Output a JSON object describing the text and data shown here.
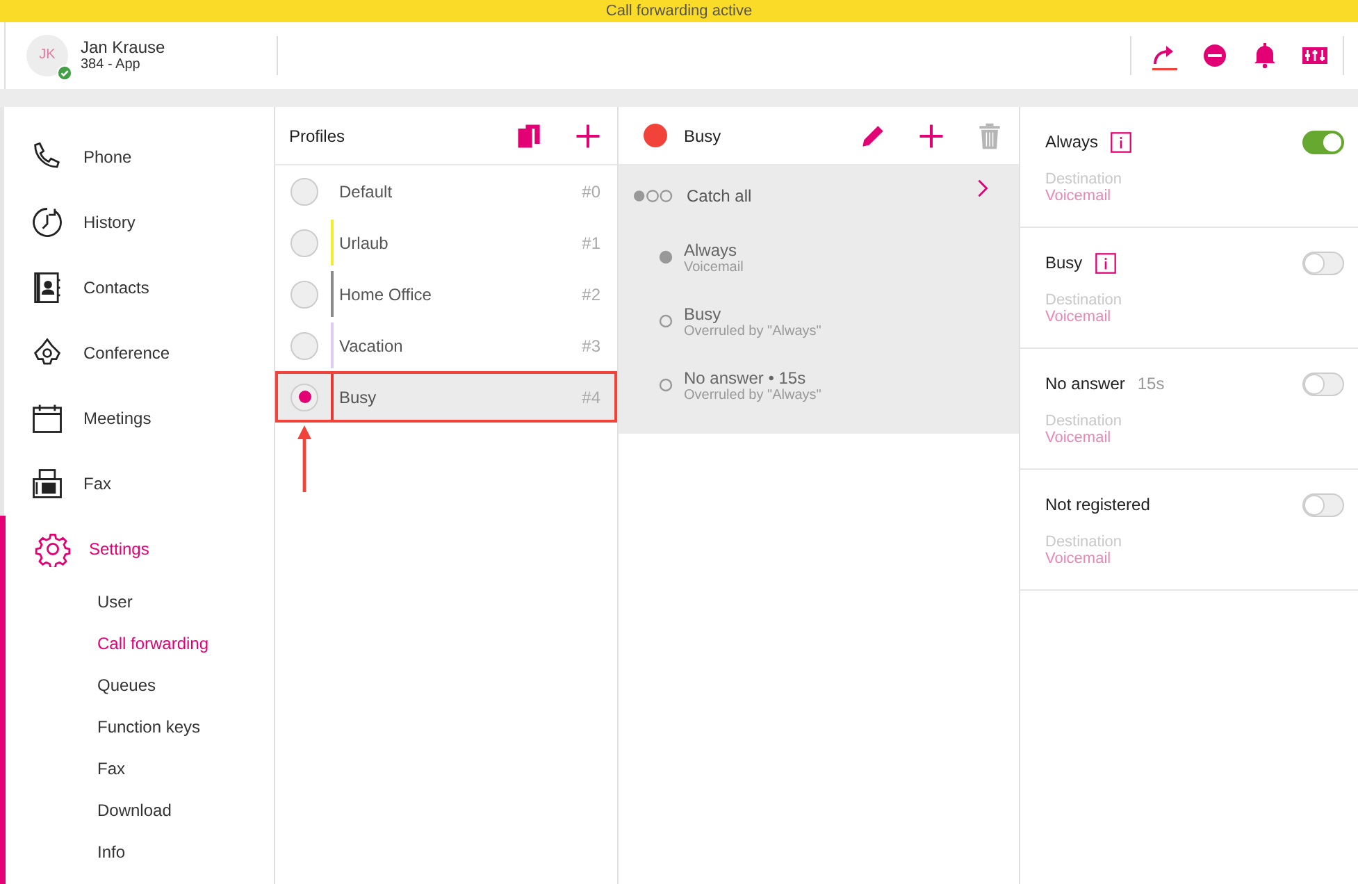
{
  "banner": {
    "text": "Call forwarding active"
  },
  "user": {
    "initials": "JK",
    "name": "Jan Krause",
    "extension": "384 - App",
    "online": true
  },
  "toolbar": [
    {
      "kind": "forward",
      "active": true
    },
    {
      "kind": "dnd",
      "active": false
    },
    {
      "kind": "bell",
      "active": false
    },
    {
      "kind": "mixer",
      "active": false
    }
  ],
  "sidebar": {
    "items": [
      {
        "label": "Phone",
        "kind": "phone",
        "selected": false
      },
      {
        "label": "History",
        "kind": "history",
        "selected": false
      },
      {
        "label": "Contacts",
        "kind": "contacts",
        "selected": false
      },
      {
        "label": "Conference",
        "kind": "conference",
        "selected": false
      },
      {
        "label": "Meetings",
        "kind": "meetings",
        "selected": false
      },
      {
        "label": "Fax",
        "kind": "fax",
        "selected": false
      },
      {
        "label": "Settings",
        "kind": "settings",
        "selected": true,
        "children": [
          {
            "label": "User",
            "selected": false
          },
          {
            "label": "Call forwarding",
            "selected": true
          },
          {
            "label": "Queues",
            "selected": false
          },
          {
            "label": "Function keys",
            "selected": false
          },
          {
            "label": "Fax",
            "selected": false
          },
          {
            "label": "Download",
            "selected": false
          },
          {
            "label": "Info",
            "selected": false
          }
        ]
      }
    ]
  },
  "profiles": {
    "title": "Profiles",
    "items": [
      {
        "name": "Default",
        "number": "#0",
        "selected": false
      },
      {
        "name": "Urlaub",
        "number": "#1",
        "selected": false,
        "color": "#f2ee2e"
      },
      {
        "name": "Home Office",
        "number": "#2",
        "selected": false,
        "color": "#8a8a8a"
      },
      {
        "name": "Vacation",
        "number": "#3",
        "selected": false,
        "color": "#dccbf2"
      },
      {
        "name": "Busy",
        "number": "#4",
        "selected": true,
        "color": "#e53935"
      }
    ]
  },
  "profile": {
    "name": "Busy",
    "color": "#f2433a",
    "group": {
      "label": "Catch all"
    },
    "rules": [
      {
        "title": "Always",
        "subtitle": "Voicemail",
        "active": true
      },
      {
        "title": "Busy",
        "subtitle": "Overruled by \"Always\"",
        "active": false
      },
      {
        "title": "No answer • 15s",
        "subtitle": "Overruled by \"Always\"",
        "active": false
      }
    ]
  },
  "forwardings": [
    {
      "title": "Always",
      "info": true,
      "on": true,
      "destination_label": "Destination",
      "destination": "Voicemail"
    },
    {
      "title": "Busy",
      "info": true,
      "on": false,
      "destination_label": "Destination",
      "destination": "Voicemail"
    },
    {
      "title": "No answer",
      "delay": "15s",
      "on": false,
      "destination_label": "Destination",
      "destination": "Voicemail"
    },
    {
      "title": "Not registered",
      "on": false,
      "destination_label": "Destination",
      "destination": "Voicemail"
    }
  ]
}
